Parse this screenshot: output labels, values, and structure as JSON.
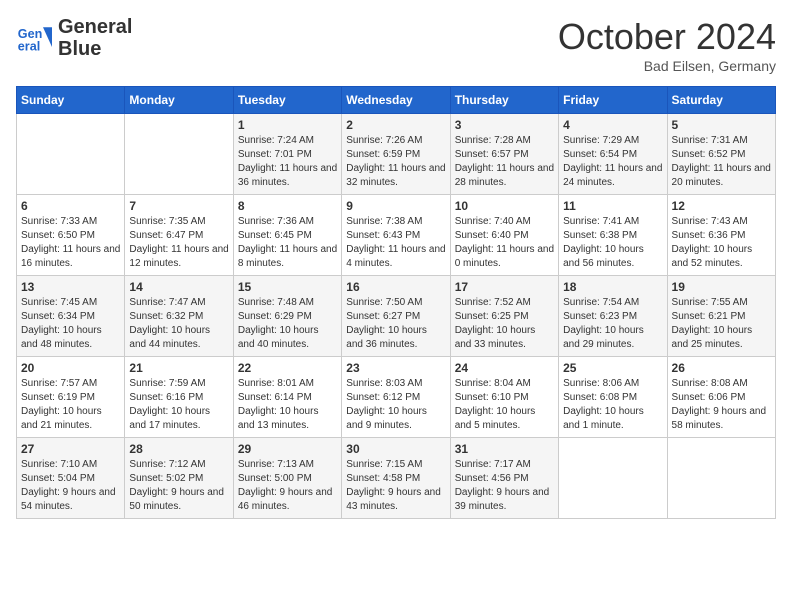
{
  "logo": {
    "line1": "General",
    "line2": "Blue"
  },
  "title": "October 2024",
  "subtitle": "Bad Eilsen, Germany",
  "days_of_week": [
    "Sunday",
    "Monday",
    "Tuesday",
    "Wednesday",
    "Thursday",
    "Friday",
    "Saturday"
  ],
  "weeks": [
    [
      {
        "day": "",
        "info": ""
      },
      {
        "day": "",
        "info": ""
      },
      {
        "day": "1",
        "info": "Sunrise: 7:24 AM\nSunset: 7:01 PM\nDaylight: 11 hours and 36 minutes."
      },
      {
        "day": "2",
        "info": "Sunrise: 7:26 AM\nSunset: 6:59 PM\nDaylight: 11 hours and 32 minutes."
      },
      {
        "day": "3",
        "info": "Sunrise: 7:28 AM\nSunset: 6:57 PM\nDaylight: 11 hours and 28 minutes."
      },
      {
        "day": "4",
        "info": "Sunrise: 7:29 AM\nSunset: 6:54 PM\nDaylight: 11 hours and 24 minutes."
      },
      {
        "day": "5",
        "info": "Sunrise: 7:31 AM\nSunset: 6:52 PM\nDaylight: 11 hours and 20 minutes."
      }
    ],
    [
      {
        "day": "6",
        "info": "Sunrise: 7:33 AM\nSunset: 6:50 PM\nDaylight: 11 hours and 16 minutes."
      },
      {
        "day": "7",
        "info": "Sunrise: 7:35 AM\nSunset: 6:47 PM\nDaylight: 11 hours and 12 minutes."
      },
      {
        "day": "8",
        "info": "Sunrise: 7:36 AM\nSunset: 6:45 PM\nDaylight: 11 hours and 8 minutes."
      },
      {
        "day": "9",
        "info": "Sunrise: 7:38 AM\nSunset: 6:43 PM\nDaylight: 11 hours and 4 minutes."
      },
      {
        "day": "10",
        "info": "Sunrise: 7:40 AM\nSunset: 6:40 PM\nDaylight: 11 hours and 0 minutes."
      },
      {
        "day": "11",
        "info": "Sunrise: 7:41 AM\nSunset: 6:38 PM\nDaylight: 10 hours and 56 minutes."
      },
      {
        "day": "12",
        "info": "Sunrise: 7:43 AM\nSunset: 6:36 PM\nDaylight: 10 hours and 52 minutes."
      }
    ],
    [
      {
        "day": "13",
        "info": "Sunrise: 7:45 AM\nSunset: 6:34 PM\nDaylight: 10 hours and 48 minutes."
      },
      {
        "day": "14",
        "info": "Sunrise: 7:47 AM\nSunset: 6:32 PM\nDaylight: 10 hours and 44 minutes."
      },
      {
        "day": "15",
        "info": "Sunrise: 7:48 AM\nSunset: 6:29 PM\nDaylight: 10 hours and 40 minutes."
      },
      {
        "day": "16",
        "info": "Sunrise: 7:50 AM\nSunset: 6:27 PM\nDaylight: 10 hours and 36 minutes."
      },
      {
        "day": "17",
        "info": "Sunrise: 7:52 AM\nSunset: 6:25 PM\nDaylight: 10 hours and 33 minutes."
      },
      {
        "day": "18",
        "info": "Sunrise: 7:54 AM\nSunset: 6:23 PM\nDaylight: 10 hours and 29 minutes."
      },
      {
        "day": "19",
        "info": "Sunrise: 7:55 AM\nSunset: 6:21 PM\nDaylight: 10 hours and 25 minutes."
      }
    ],
    [
      {
        "day": "20",
        "info": "Sunrise: 7:57 AM\nSunset: 6:19 PM\nDaylight: 10 hours and 21 minutes."
      },
      {
        "day": "21",
        "info": "Sunrise: 7:59 AM\nSunset: 6:16 PM\nDaylight: 10 hours and 17 minutes."
      },
      {
        "day": "22",
        "info": "Sunrise: 8:01 AM\nSunset: 6:14 PM\nDaylight: 10 hours and 13 minutes."
      },
      {
        "day": "23",
        "info": "Sunrise: 8:03 AM\nSunset: 6:12 PM\nDaylight: 10 hours and 9 minutes."
      },
      {
        "day": "24",
        "info": "Sunrise: 8:04 AM\nSunset: 6:10 PM\nDaylight: 10 hours and 5 minutes."
      },
      {
        "day": "25",
        "info": "Sunrise: 8:06 AM\nSunset: 6:08 PM\nDaylight: 10 hours and 1 minute."
      },
      {
        "day": "26",
        "info": "Sunrise: 8:08 AM\nSunset: 6:06 PM\nDaylight: 9 hours and 58 minutes."
      }
    ],
    [
      {
        "day": "27",
        "info": "Sunrise: 7:10 AM\nSunset: 5:04 PM\nDaylight: 9 hours and 54 minutes."
      },
      {
        "day": "28",
        "info": "Sunrise: 7:12 AM\nSunset: 5:02 PM\nDaylight: 9 hours and 50 minutes."
      },
      {
        "day": "29",
        "info": "Sunrise: 7:13 AM\nSunset: 5:00 PM\nDaylight: 9 hours and 46 minutes."
      },
      {
        "day": "30",
        "info": "Sunrise: 7:15 AM\nSunset: 4:58 PM\nDaylight: 9 hours and 43 minutes."
      },
      {
        "day": "31",
        "info": "Sunrise: 7:17 AM\nSunset: 4:56 PM\nDaylight: 9 hours and 39 minutes."
      },
      {
        "day": "",
        "info": ""
      },
      {
        "day": "",
        "info": ""
      }
    ]
  ]
}
